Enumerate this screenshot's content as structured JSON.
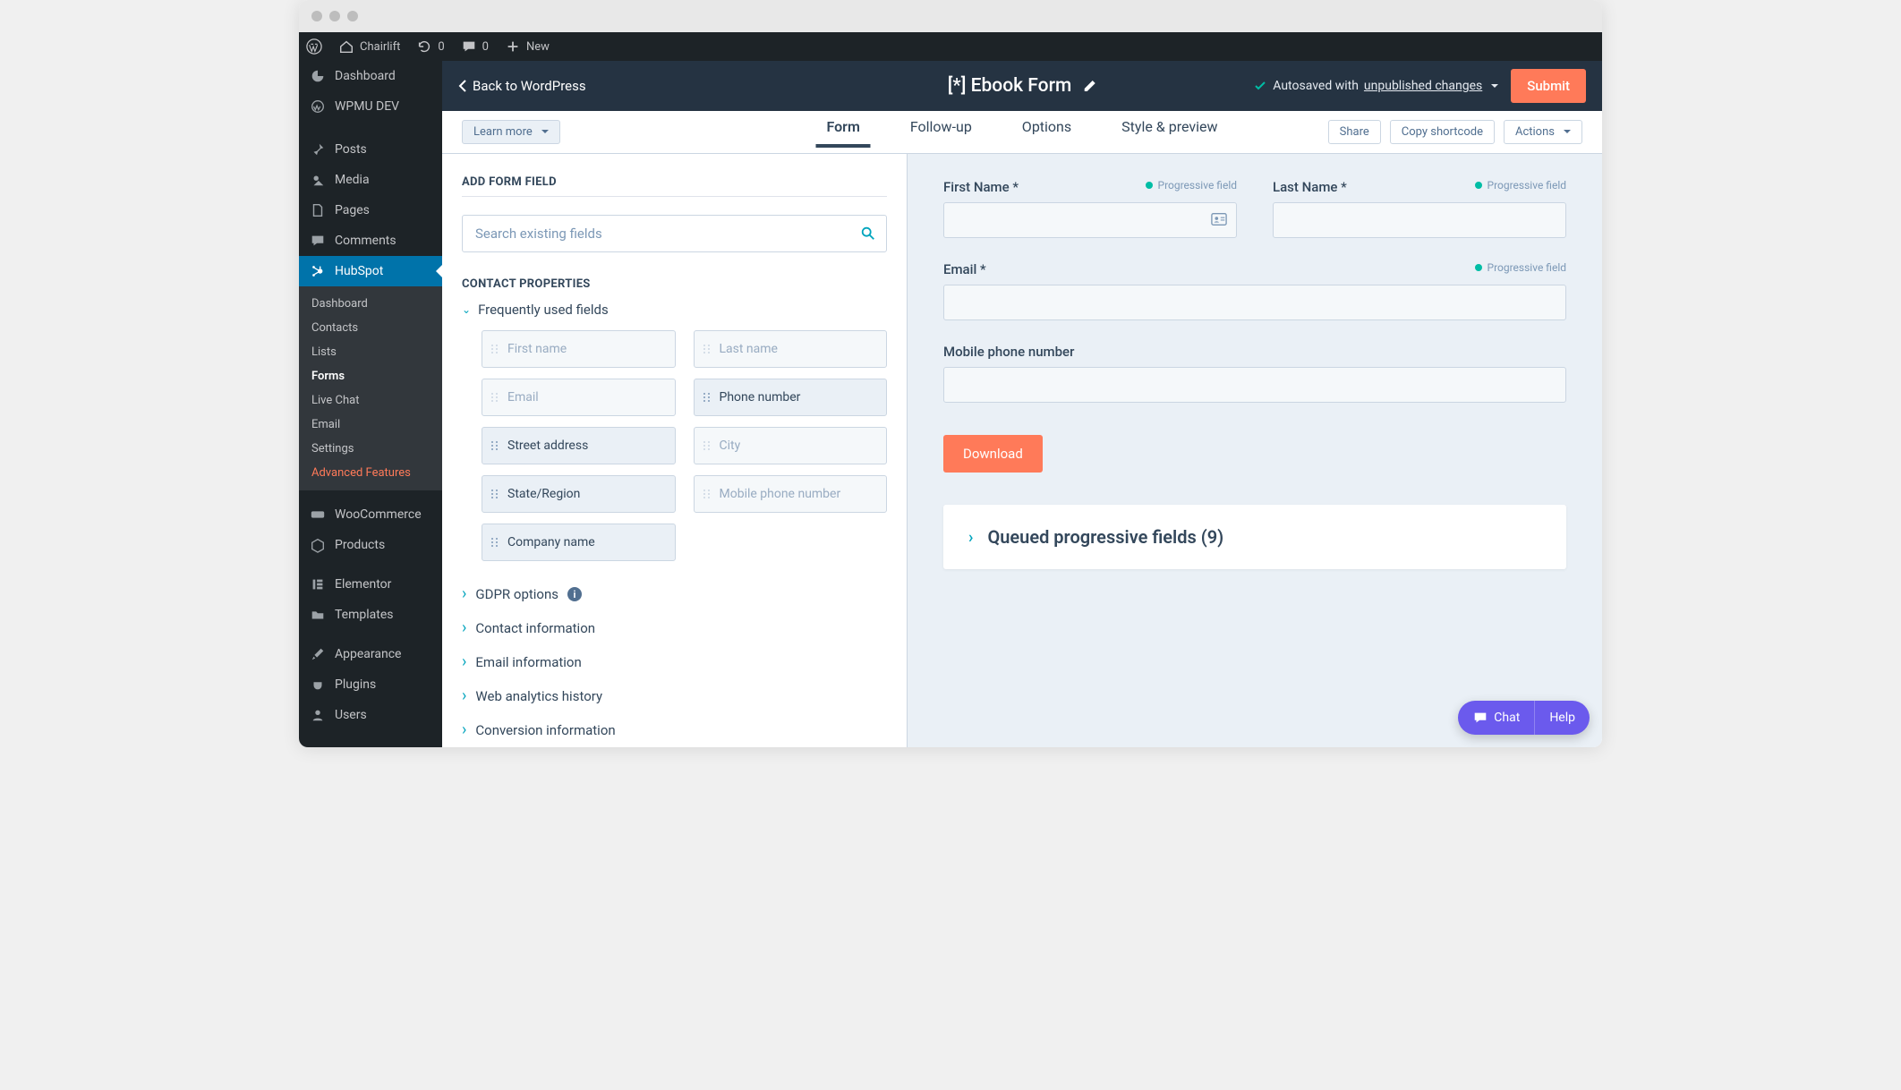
{
  "wp_adminbar": {
    "site_name": "Chairlift",
    "refresh_count": "0",
    "comments_count": "0",
    "new_label": "New"
  },
  "wp_sidebar": {
    "top_items": [
      {
        "label": "Dashboard",
        "icon": "gauge"
      },
      {
        "label": "WPMU DEV",
        "icon": "wpmu"
      }
    ],
    "content_items": [
      {
        "label": "Posts",
        "icon": "pin"
      },
      {
        "label": "Media",
        "icon": "media"
      },
      {
        "label": "Pages",
        "icon": "page"
      },
      {
        "label": "Comments",
        "icon": "comment"
      }
    ],
    "hubspot_label": "HubSpot",
    "hubspot_submenu": [
      {
        "label": "Dashboard"
      },
      {
        "label": "Contacts"
      },
      {
        "label": "Lists"
      },
      {
        "label": "Forms",
        "current": true
      },
      {
        "label": "Live Chat"
      },
      {
        "label": "Email"
      },
      {
        "label": "Settings"
      },
      {
        "label": "Advanced Features",
        "accent": true
      }
    ],
    "tail_items": [
      {
        "label": "WooCommerce",
        "icon": "woo"
      },
      {
        "label": "Products",
        "icon": "box"
      },
      {
        "label": "Elementor",
        "icon": "elementor"
      },
      {
        "label": "Templates",
        "icon": "folder"
      },
      {
        "label": "Appearance",
        "icon": "brush"
      },
      {
        "label": "Plugins",
        "icon": "plug"
      },
      {
        "label": "Users",
        "icon": "user"
      }
    ]
  },
  "hs_topbar": {
    "back_label": "Back to WordPress",
    "form_title": "[*] Ebook Form",
    "autosaved_prefix": "Autosaved with ",
    "autosaved_link": "unpublished changes",
    "submit_label": "Submit"
  },
  "hs_tabbar": {
    "learn_more": "Learn more",
    "tabs": [
      {
        "label": "Form",
        "active": true
      },
      {
        "label": "Follow-up"
      },
      {
        "label": "Options"
      },
      {
        "label": "Style & preview"
      }
    ],
    "share": "Share",
    "copy_shortcode": "Copy shortcode",
    "actions": "Actions"
  },
  "left_panel": {
    "add_field_title": "ADD FORM FIELD",
    "search_placeholder": "Search existing fields",
    "contact_props_title": "CONTACT PROPERTIES",
    "freq_used_label": "Frequently used fields",
    "fields": [
      {
        "label": "First name",
        "disabled": true
      },
      {
        "label": "Last name",
        "disabled": true
      },
      {
        "label": "Email",
        "disabled": true
      },
      {
        "label": "Phone number",
        "disabled": false
      },
      {
        "label": "Street address",
        "disabled": false
      },
      {
        "label": "City",
        "disabled": true
      },
      {
        "label": "State/Region",
        "disabled": false
      },
      {
        "label": "Mobile phone number",
        "disabled": true
      },
      {
        "label": "Company name",
        "disabled": false
      }
    ],
    "categories": [
      {
        "label": "GDPR options",
        "info": true
      },
      {
        "label": "Contact information"
      },
      {
        "label": "Email information"
      },
      {
        "label": "Web analytics history"
      },
      {
        "label": "Conversion information"
      }
    ]
  },
  "right_panel": {
    "progressive_label": "Progressive field",
    "first_name_label": "First Name *",
    "last_name_label": "Last Name *",
    "email_label": "Email *",
    "mobile_label": "Mobile phone number",
    "download_label": "Download",
    "queued_label": "Queued progressive fields (9)"
  },
  "help_widget": {
    "chat": "Chat",
    "help": "Help"
  }
}
